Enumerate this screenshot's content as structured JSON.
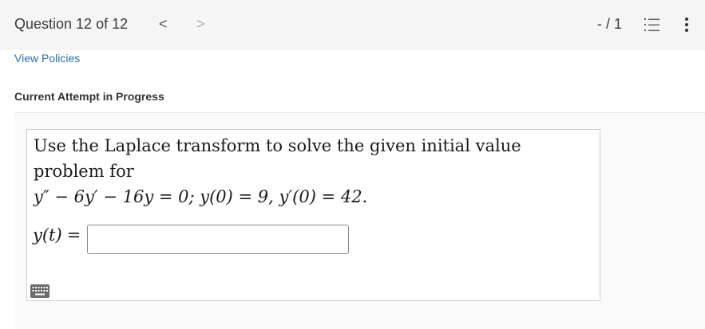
{
  "header": {
    "question_counter": "Question 12 of 12",
    "prev_glyph": "<",
    "next_glyph": ">",
    "score": "- / 1",
    "list_icon": "list-icon",
    "more_icon": "more-vertical-icon"
  },
  "links": {
    "view_policies": "View Policies"
  },
  "status": {
    "attempt": "Current Attempt in Progress"
  },
  "question": {
    "text": "Use the Laplace transform to solve the given initial value problem for",
    "equation": "y″ − 6y′ − 16y = 0; y(0) = 9, y′(0) = 42.",
    "answer_label": "y(t)",
    "answer_equals": "=",
    "answer_value": "",
    "keyboard_icon": "keyboard-icon"
  },
  "colors": {
    "link": "#2a6fab",
    "topbar_bg": "#f5f5f5",
    "box_border": "#cfcfcf"
  }
}
